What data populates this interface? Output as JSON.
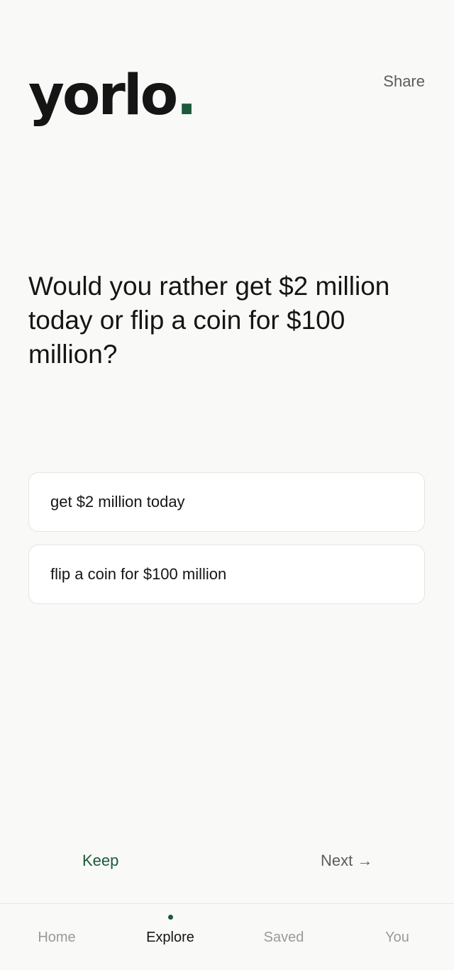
{
  "header": {
    "logo_text": "yorlo",
    "logo_dot": ".",
    "share_label": "Share"
  },
  "question": {
    "text": "Would you rather get $2 million today or flip a coin for $100 million?"
  },
  "options": [
    {
      "label": "get $2 million today"
    },
    {
      "label": "flip a coin for $100 million"
    }
  ],
  "actions": {
    "keep_label": "Keep",
    "next_label": "Next →"
  },
  "nav": {
    "items": [
      {
        "label": "Home"
      },
      {
        "label": "Explore",
        "active": true
      },
      {
        "label": "Saved"
      },
      {
        "label": "You"
      }
    ]
  },
  "colors": {
    "accent": "#1c5a3c",
    "background": "#f9f9f7",
    "text": "#151515",
    "muted": "#9a9a98"
  }
}
